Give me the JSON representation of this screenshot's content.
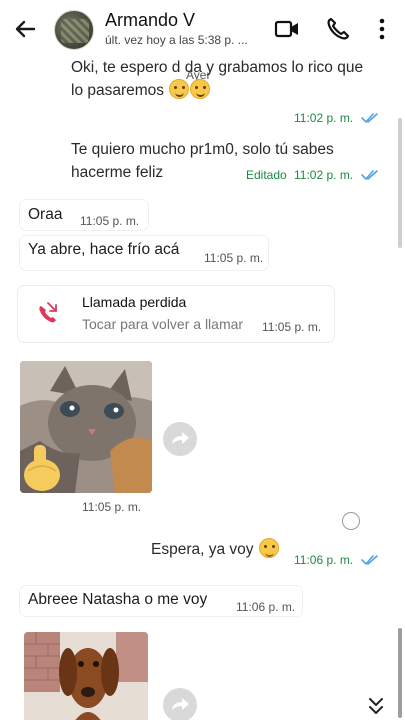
{
  "header": {
    "contact_name": "Armando V",
    "last_seen": "últ. vez hoy a las 5:38 p. ..."
  },
  "chat": {
    "day_chip": "Ayer",
    "messages": [
      {
        "type": "outgoing",
        "text": "Oki, te espero d    da y grabamos lo rico que lo pasaremos",
        "emojis": [
          "grinning-sweat-emoji",
          "grinning-sweat-emoji"
        ],
        "time": "11:02 p. m."
      },
      {
        "type": "outgoing",
        "text": "Te quiero mucho pr1m0, solo tú sabes hacerme feliz",
        "edited_label": "Editado",
        "time": "11:02 p. m."
      },
      {
        "type": "incoming",
        "text": "Oraa",
        "time": "11:05 p. m."
      },
      {
        "type": "incoming",
        "text": "Ya abre, hace frío acá",
        "time": "11:05 p. m."
      },
      {
        "type": "missed-call",
        "title": "Llamada perdida",
        "subtitle": "Tocar para volver a llamar",
        "time": "11:05 p. m."
      },
      {
        "type": "incoming-image",
        "subject": "kitten with middle finger emoji",
        "time": "11:05 p. m."
      },
      {
        "type": "outgoing",
        "text": "Espera, ya voy",
        "emojis": [
          "unamused-face-emoji"
        ],
        "time": "11:06 p. m."
      },
      {
        "type": "incoming",
        "text": "Abreee Natasha o me voy",
        "time": "11:06 p. m."
      },
      {
        "type": "incoming-image",
        "subject": "dachshund dog"
      }
    ]
  },
  "colors": {
    "time_outgoing": "#1c8a45",
    "ticks_read": "#4fa3e0",
    "missed_call": "#e0385a"
  }
}
